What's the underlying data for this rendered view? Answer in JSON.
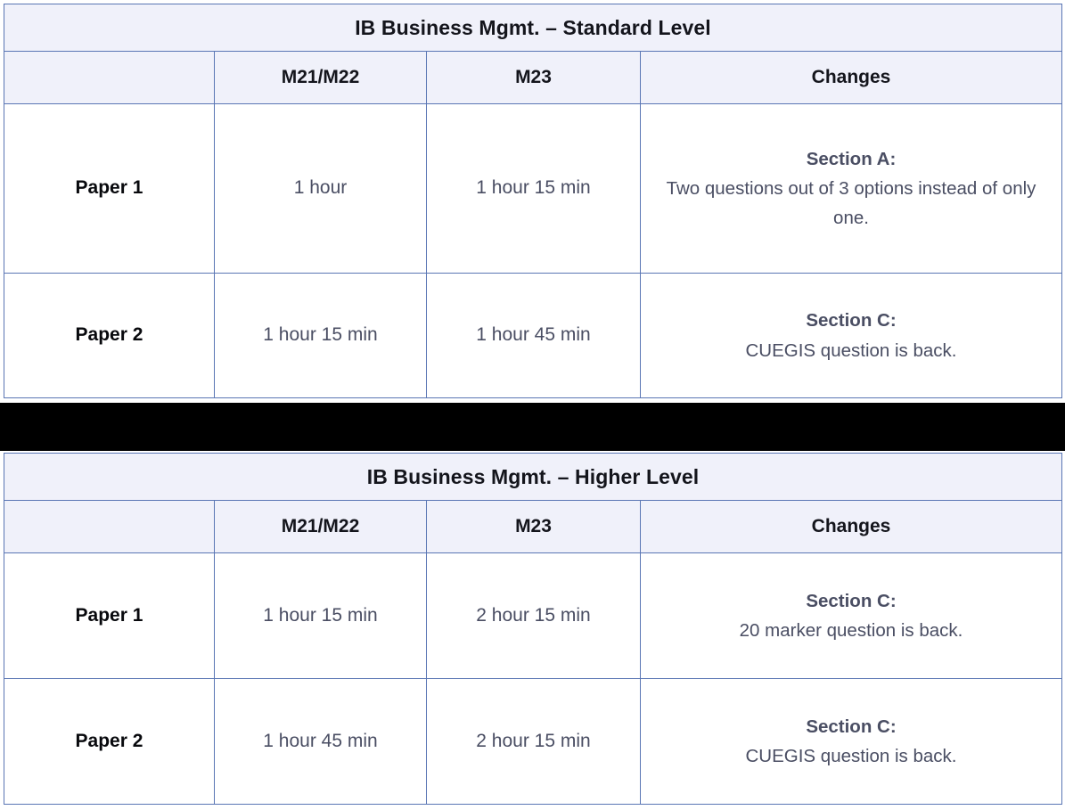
{
  "tables": [
    {
      "title": "IB Business Mgmt. – Standard Level",
      "columns": [
        "",
        "M21/M22",
        "M23",
        "Changes"
      ],
      "rows": [
        {
          "label": "Paper 1",
          "m21_m22": "1 hour",
          "m23": "1 hour 15 min",
          "changes_heading": "Section A:",
          "changes_body": "Two questions out of 3 options instead of only one."
        },
        {
          "label": "Paper 2",
          "m21_m22": "1 hour 15 min",
          "m23": "1 hour 45 min",
          "changes_heading": "Section C:",
          "changes_body": "CUEGIS question is back."
        }
      ]
    },
    {
      "title": "IB Business Mgmt. – Higher Level",
      "columns": [
        "",
        "M21/M22",
        "M23",
        "Changes"
      ],
      "rows": [
        {
          "label": "Paper 1",
          "m21_m22": "1 hour 15 min",
          "m23": "2 hour 15 min",
          "changes_heading": "Section C:",
          "changes_body": "20 marker question is back."
        },
        {
          "label": "Paper 2",
          "m21_m22": "1 hour 45 min",
          "m23": "2 hour 15 min",
          "changes_heading": "Section C:",
          "changes_body": "CUEGIS question is back."
        }
      ]
    }
  ],
  "separator": {
    "kind": "black-band"
  },
  "colors": {
    "border": "#5a76b4",
    "header_background": "#f0f1fa",
    "header_text": "#14151c",
    "body_text": "#4a4e63",
    "label_text": "#08090d",
    "separator": "#000000",
    "page_background": "#ffffff"
  }
}
